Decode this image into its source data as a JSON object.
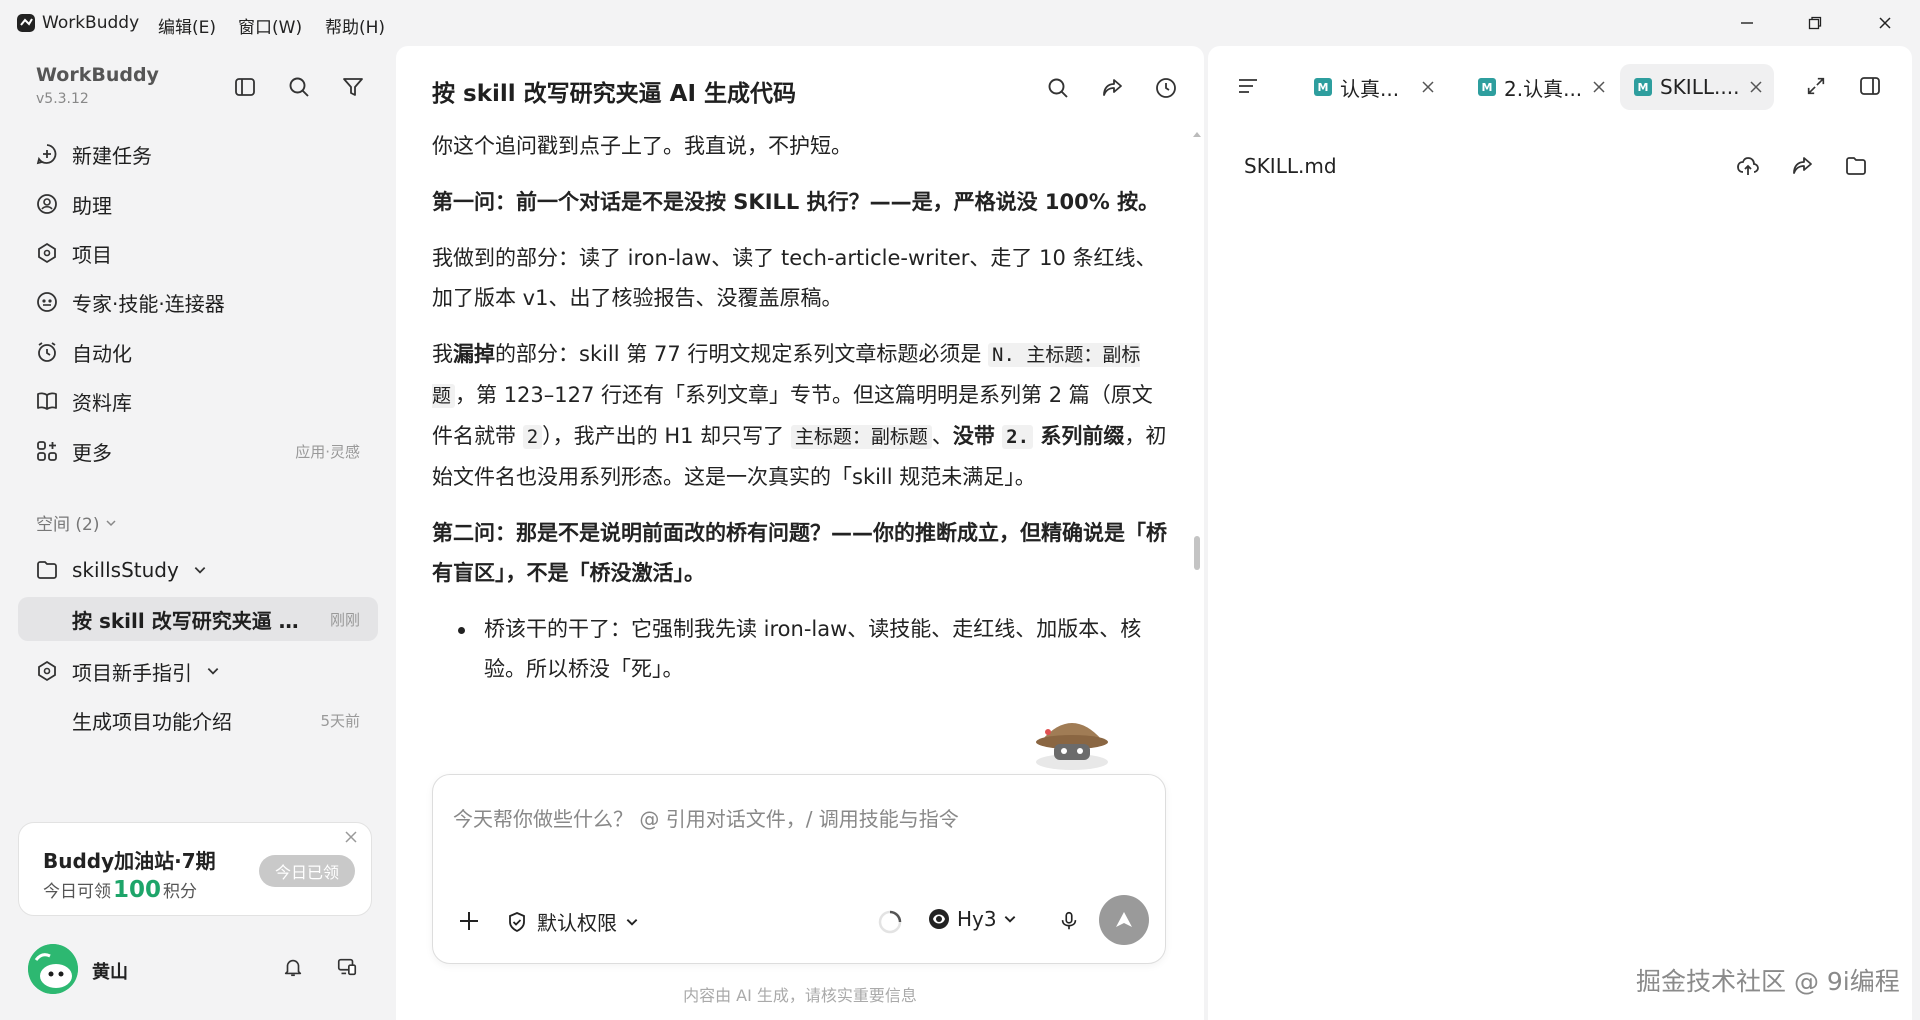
{
  "titlebar": {
    "app_name": "WorkBuddy",
    "menus": [
      "编辑(E)",
      "窗口(W)",
      "帮助(H)"
    ]
  },
  "sidebar": {
    "title": "WorkBuddy",
    "version": "v5.3.12",
    "nav": [
      {
        "label": "新建任务",
        "icon": "new-task-icon"
      },
      {
        "label": "助理",
        "icon": "assistant-icon"
      },
      {
        "label": "项目",
        "icon": "project-icon"
      },
      {
        "label": "专家·技能·连接器",
        "icon": "expert-icon"
      },
      {
        "label": "自动化",
        "icon": "automation-icon"
      },
      {
        "label": "资料库",
        "icon": "library-icon"
      },
      {
        "label": "更多",
        "icon": "more-icon",
        "right": "应用·灵感"
      }
    ],
    "spaces_label": "空间 (2)",
    "space1": {
      "label": "skillsStudy"
    },
    "task_active": {
      "label": "按 skill 改写研究夹逼 AI...",
      "time": "刚刚"
    },
    "space2": {
      "label": "项目新手指引"
    },
    "task2": {
      "label": "生成项目功能介绍",
      "time": "5天前"
    },
    "promo": {
      "title": "Buddy加油站·7期",
      "sub_prefix": "今日可领",
      "points": "100",
      "sub_suffix": "积分",
      "button": "今日已领"
    },
    "user": {
      "name": "黄山"
    }
  },
  "chat": {
    "title": "按 skill 改写研究夹逼 AI 生成代码",
    "p1": "你这个追问戳到点子上了。我直说，不护短。",
    "p2": "第一问：前一个对话是不是没按 SKILL 执行？——是，严格说没 100% 按。",
    "p3": "我做到的部分：读了 iron-law、读了 tech-article-writer、走了 10 条红线、加了版本 v1、出了核验报告、没覆盖原稿。",
    "p4": {
      "t1": "我",
      "b1": "漏掉",
      "t2": "的部分：skill 第 77 行明文规定系列文章标题必须是 ",
      "c1": "N. 主标题：副标题",
      "t3": "，第 123–127 行还有「系列文章」专节。但这篇明明是系列第 2 篇（原文件名就带 ",
      "c2": "2",
      "t4": "），我产出的 H1 却只写了 ",
      "c3": "主标题：副标题",
      "t5": "、",
      "b2": "没带 ",
      "c4": "2.",
      "b3": " 系列前缀",
      "t6": "，初始文件名也没用系列形态。这是一次真实的「skill 规范未满足」。"
    },
    "p5": "第二问：那是不是说明前面改的桥有问题？——你的推断成立，但精确说是「桥有盲区」，不是「桥没激活」。",
    "bullet1": "桥该干的干了：它强制我先读 iron-law、读技能、走红线、加版本、核验。所以桥没「死」。",
    "input_placeholder": "今天帮你做些什么？ @ 引用对话文件，/ 调用技能与指令",
    "perm_label": "默认权限",
    "model_label": "Hy3",
    "disclaimer": "内容由 AI 生成，请核实重要信息"
  },
  "right": {
    "tabs": [
      {
        "label": "认真..."
      },
      {
        "label": "2.认真..."
      },
      {
        "label": "SKILL...."
      }
    ],
    "tab_badge": "M",
    "file_name": "SKILL.md"
  },
  "watermark": "掘金技术社区 @ 9i编程",
  "colors": {
    "accent": "#1ea56a",
    "md_badge": "#2e9e9e",
    "send_button": "#9a9a9a"
  }
}
